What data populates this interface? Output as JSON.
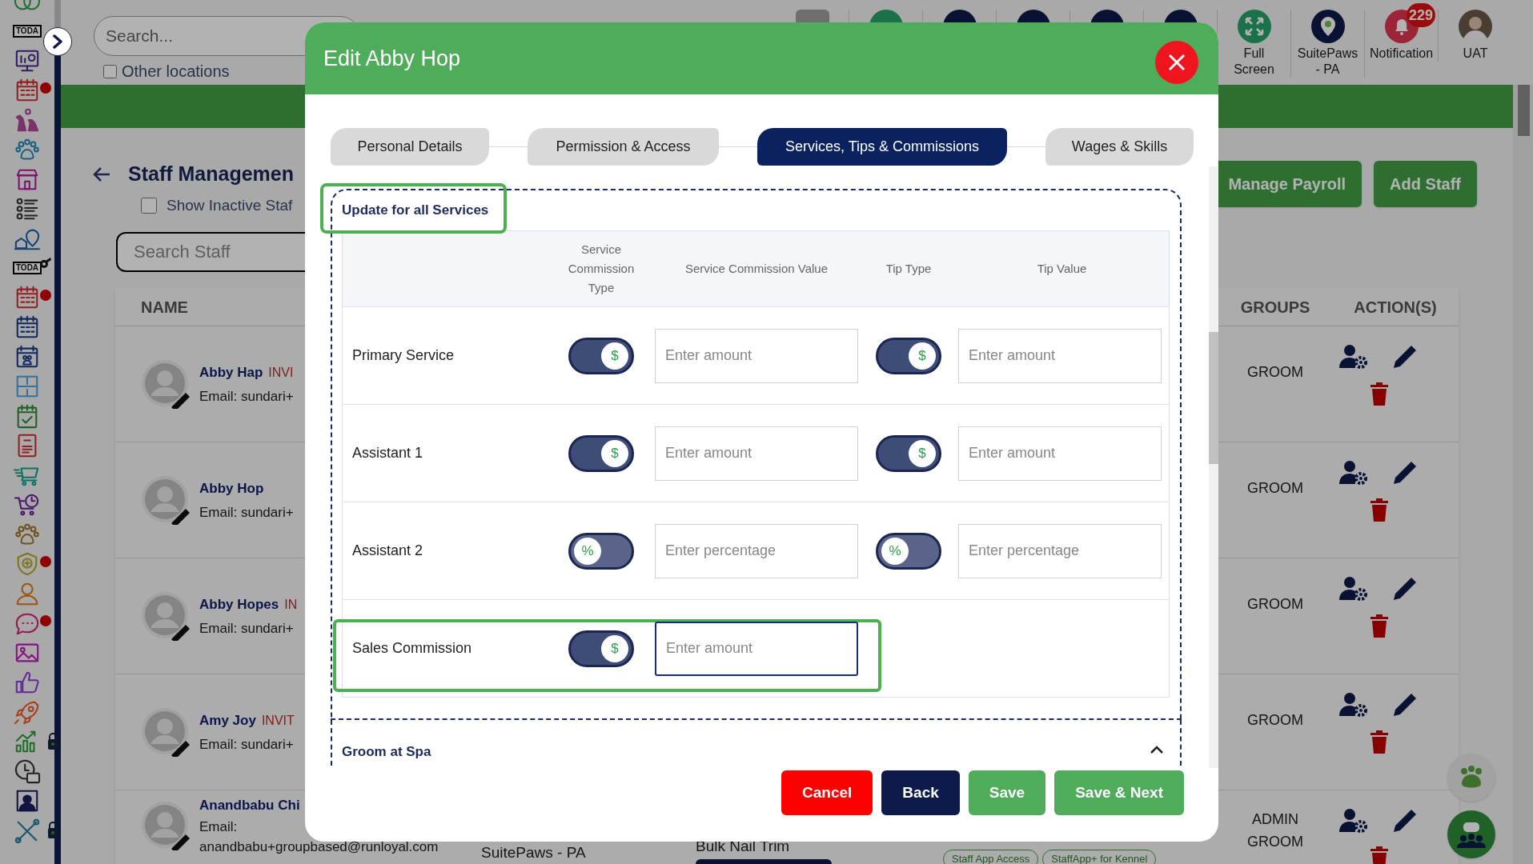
{
  "sidebar": {
    "items": [
      {
        "kind": "rings",
        "badge": false,
        "locked": false
      },
      {
        "kind": "sign",
        "text": "TODA",
        "badge": false,
        "locked": false
      },
      {
        "kind": "monitor",
        "badge": false,
        "locked": false
      },
      {
        "kind": "calendar",
        "badge": true,
        "locked": false
      },
      {
        "kind": "dogs",
        "badge": false,
        "locked": false
      },
      {
        "kind": "paw",
        "badge": false,
        "locked": false
      },
      {
        "kind": "store",
        "badge": false,
        "locked": false
      },
      {
        "kind": "stafflist",
        "badge": false,
        "locked": false
      },
      {
        "kind": "location",
        "badge": false,
        "locked": false
      },
      {
        "kind": "whistle",
        "text": "TODA",
        "badge": false,
        "locked": false
      },
      {
        "kind": "calendar",
        "badge": true,
        "locked": false
      },
      {
        "kind": "calendar",
        "badge": false,
        "locked": false
      },
      {
        "kind": "calendarpaw",
        "badge": false,
        "locked": false
      },
      {
        "kind": "floorplan",
        "badge": false,
        "locked": false
      },
      {
        "kind": "calendarcheck",
        "badge": false,
        "locked": false
      },
      {
        "kind": "document",
        "badge": false,
        "locked": false
      },
      {
        "kind": "cart",
        "badge": false,
        "locked": false
      },
      {
        "kind": "cartclock",
        "badge": false,
        "locked": false
      },
      {
        "kind": "paw",
        "badge": false,
        "locked": false
      },
      {
        "kind": "shield",
        "badge": true,
        "locked": false
      },
      {
        "kind": "person",
        "badge": false,
        "locked": false
      },
      {
        "kind": "chat",
        "badge": true,
        "locked": false
      },
      {
        "kind": "image",
        "badge": false,
        "locked": false
      },
      {
        "kind": "thumb",
        "badge": false,
        "locked": false
      },
      {
        "kind": "rocket",
        "badge": false,
        "locked": false
      },
      {
        "kind": "chart",
        "badge": false,
        "locked": true
      },
      {
        "kind": "clockcase",
        "badge": false,
        "locked": false
      },
      {
        "kind": "staffbadge",
        "badge": false,
        "locked": false
      },
      {
        "kind": "tools",
        "badge": false,
        "locked": true
      }
    ]
  },
  "header": {
    "search": {
      "placeholder": "Search..."
    },
    "other_locations": {
      "label": "Other locations",
      "checked": false
    },
    "toolbar": [
      {
        "kind": "fullscreen",
        "label": "Full Screen"
      },
      {
        "kind": "location",
        "label": "SuitePaws - PA"
      },
      {
        "kind": "notification",
        "label": "Notification",
        "badge": "229"
      },
      {
        "kind": "profile",
        "label": "UAT"
      }
    ]
  },
  "page": {
    "title": "Staff Managemen",
    "show_inactive": {
      "label": "Show Inactive Staf",
      "checked": false
    },
    "search": {
      "placeholder": "Search Staff"
    },
    "buttons": [
      "Manage Payroll",
      "Add Staff"
    ],
    "table": {
      "columns": [
        "NAME",
        "GROUPS",
        "ACTION(S)"
      ],
      "rows": [
        {
          "name": "Abby Hap",
          "status": "INVI",
          "email": [
            "Email: sundari+"
          ],
          "groups": [
            "GROOM"
          ]
        },
        {
          "name": "Abby Hop",
          "email": [
            "Email: sundari+"
          ],
          "groups": [
            "GROOM"
          ]
        },
        {
          "name": "Abby Hopes",
          "status": "IN",
          "email": [
            "Email: sundari+"
          ],
          "groups": [
            "GROOM"
          ]
        },
        {
          "name": "Amy Joy",
          "status": "INVIT",
          "email": [
            "Email: sundari+"
          ],
          "groups": [
            "GROOM"
          ]
        },
        {
          "name": "Anandbabu Chi",
          "email": [
            "Email:",
            "anandbabu+groupbased@runloyal.com"
          ],
          "location": "SuitePaws - PA",
          "service": "Bulk Nail Trim",
          "tags": [
            "Staff App Access",
            "StaffApp+ for Kennel"
          ],
          "groups": [
            "ADMIN",
            "GROOM"
          ]
        }
      ]
    }
  },
  "modal": {
    "title": "Edit Abby Hop",
    "tabs": [
      {
        "label": "Personal Details",
        "selected": false
      },
      {
        "label": "Permission & Access",
        "selected": false
      },
      {
        "label": "Services, Tips & Commissions",
        "selected": true
      },
      {
        "label": "Wages & Skills",
        "selected": false
      }
    ],
    "section": {
      "title": "Update for all Services",
      "highlighted": true,
      "columns": [
        "Service Commission Type",
        "Service Commission Value",
        "Tip Type",
        "Tip Value"
      ],
      "rows": [
        {
          "label": "Primary Service",
          "highlighted": false,
          "commission": {
            "symbol": "$",
            "on": true,
            "placeholder": "Enter amount",
            "focused": false
          },
          "tip": {
            "symbol": "$",
            "on": true,
            "placeholder": "Enter amount"
          }
        },
        {
          "label": "Assistant 1",
          "highlighted": false,
          "commission": {
            "symbol": "$",
            "on": true,
            "placeholder": "Enter amount",
            "focused": false
          },
          "tip": {
            "symbol": "$",
            "on": true,
            "placeholder": "Enter amount"
          }
        },
        {
          "label": "Assistant 2",
          "highlighted": false,
          "commission": {
            "symbol": "%",
            "on": false,
            "placeholder": "Enter percentage",
            "focused": false
          },
          "tip": {
            "symbol": "%",
            "on": false,
            "placeholder": "Enter percentage"
          }
        },
        {
          "label": "Sales Commission",
          "highlighted": true,
          "commission": {
            "symbol": "$",
            "on": true,
            "placeholder": "Enter amount",
            "focused": true
          }
        }
      ]
    },
    "group": {
      "title": "Groom at Spa",
      "expanded": true
    },
    "buttons": [
      {
        "label": "Cancel",
        "kind": "danger"
      },
      {
        "label": "Back",
        "kind": "secondary"
      },
      {
        "label": "Save",
        "kind": "primary"
      },
      {
        "label": "Save & Next",
        "kind": "primary"
      }
    ]
  }
}
